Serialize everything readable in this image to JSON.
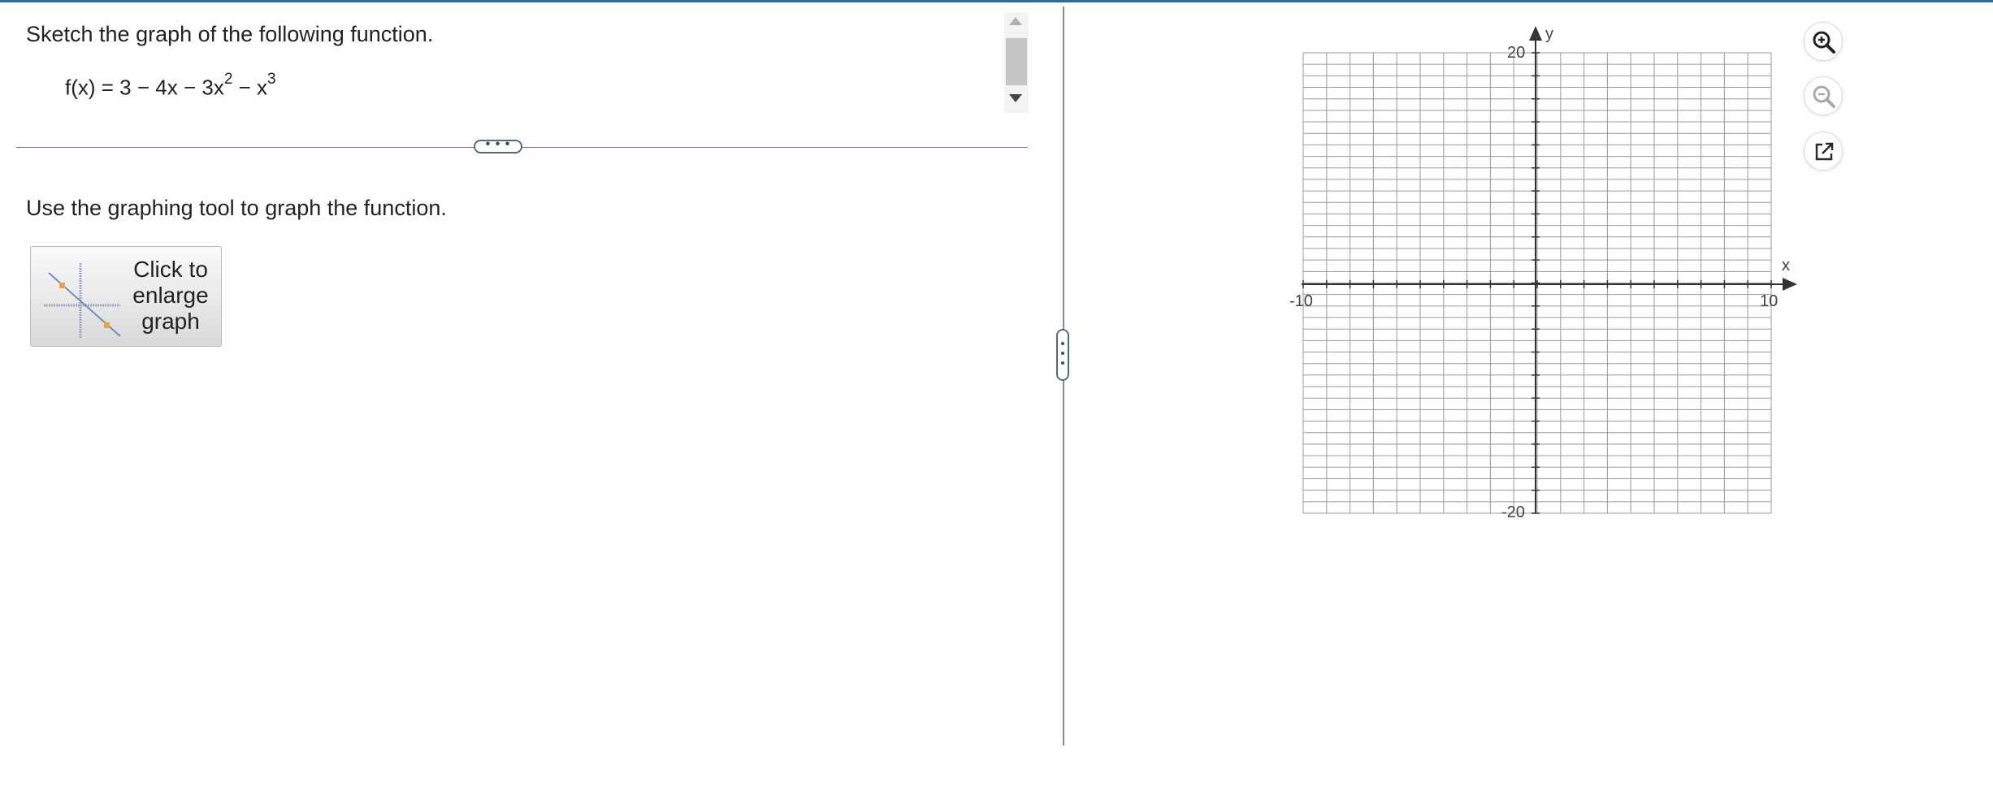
{
  "question": {
    "instruction": "Sketch the graph of the following function.",
    "formula": {
      "part1": "f(x) = 3 − 4x − 3x",
      "exp1": "2",
      "part2": " − x",
      "exp2": "3"
    },
    "divider_handle": "• • •",
    "prompt": "Use the graphing tool to graph the function.",
    "enlarge_button": {
      "line1": "Click to",
      "line2": "enlarge",
      "line3": "graph"
    }
  },
  "graph": {
    "x_axis_label": "x",
    "y_axis_label": "y",
    "x_min_label": "-10",
    "x_max_label": "10",
    "y_max_label": "20",
    "y_min_label": "-20",
    "x_range": [
      -10,
      10
    ],
    "y_range": [
      -20,
      20
    ],
    "grid": true
  },
  "tools": {
    "zoom_in": "zoom-in-icon",
    "zoom_out": "zoom-out-icon",
    "pop_out": "external-link-icon"
  },
  "colors": {
    "accent": "#2a6f8f",
    "grid": "#9a9a9a",
    "axis": "#333333",
    "handle_border": "#506a86"
  }
}
